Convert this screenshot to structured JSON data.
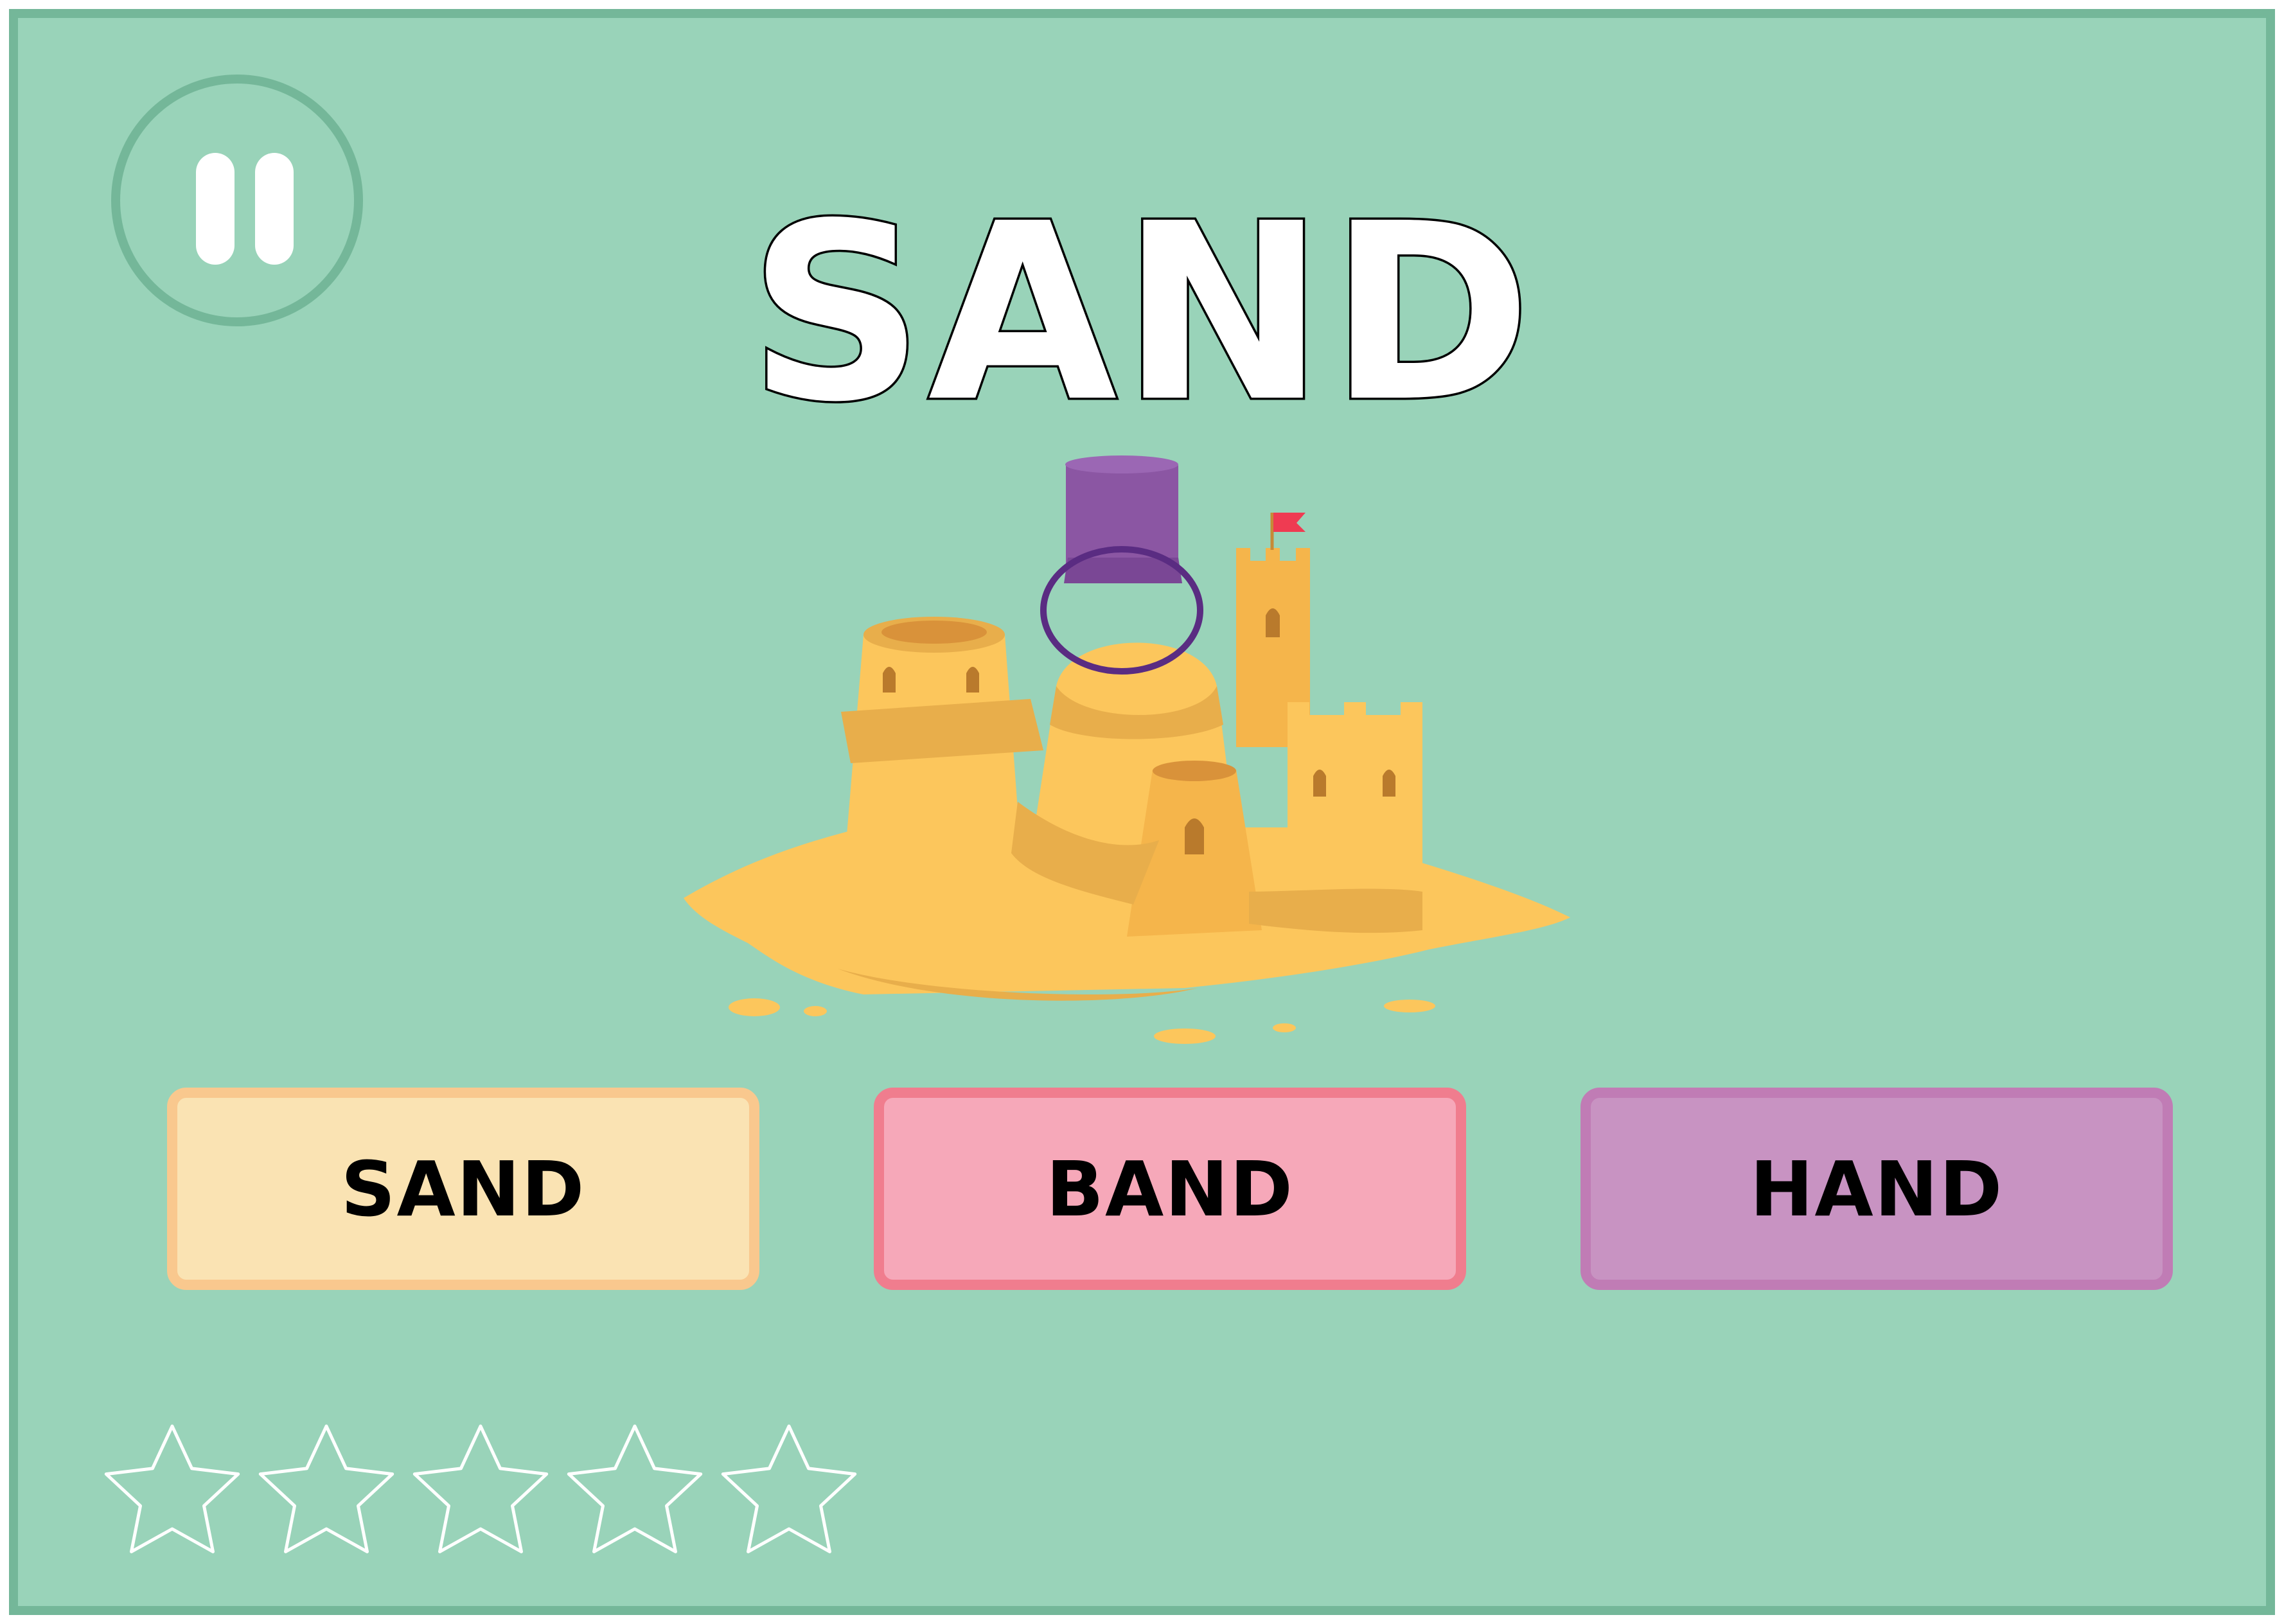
{
  "game": {
    "target_word": "SAND",
    "picture_icon": "sandcastle-with-bucket"
  },
  "controls": {
    "pause_icon": "pause-icon"
  },
  "answers": [
    {
      "label": "SAND",
      "fill": "#fae3b3",
      "border": "#f9c88e"
    },
    {
      "label": "BAND",
      "fill": "#f6a8b9",
      "border": "#f07d8e"
    },
    {
      "label": "HAND",
      "fill": "#c893c2",
      "border": "#c07cb5"
    }
  ],
  "progress": {
    "stars_total": 5,
    "stars_earned": 0
  },
  "colors": {
    "background": "#99d3b9",
    "frame": "#74b799",
    "star_outline": "#ffffff"
  }
}
